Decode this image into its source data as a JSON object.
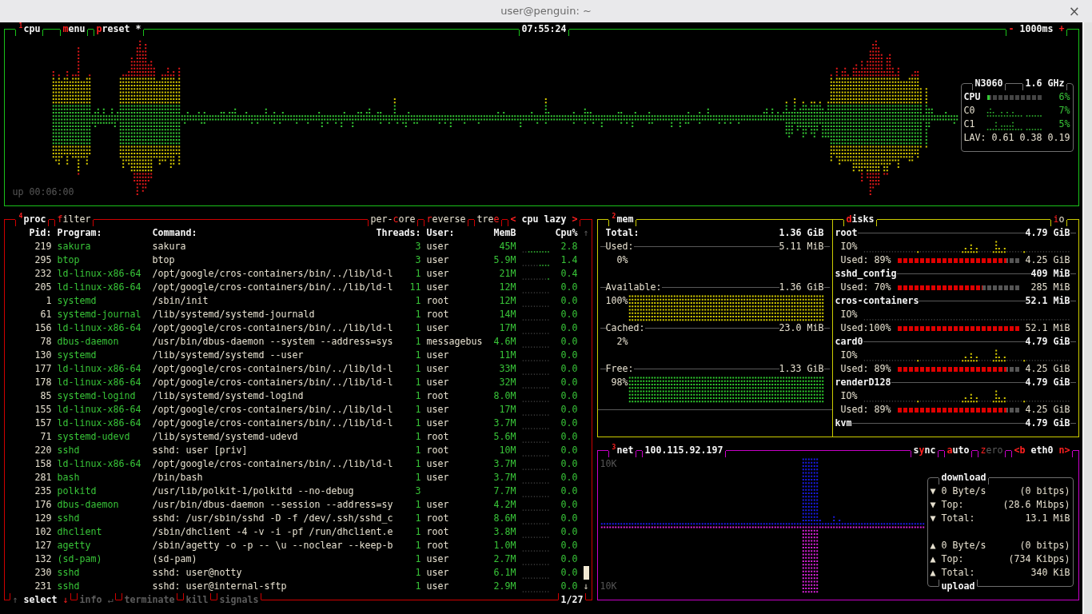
{
  "window": {
    "title": "user@penguin: ~",
    "close": "×"
  },
  "cpu": {
    "title": "$^{1}$cpu",
    "options": [
      {
        "key": "m",
        "after": "enu"
      },
      {
        "key": "p",
        "after": "reset *"
      }
    ],
    "clock": "07:55:24",
    "interval": {
      "minus": "-",
      "value": "1000ms",
      "plus": "+"
    },
    "uptime": "up 00:06:00",
    "info": {
      "model": "N3060",
      "frequency": "1.6 GHz",
      "total": {
        "label": "CPU",
        "level": 0.06,
        "value": "6%"
      },
      "cores": [
        {
          "label": "C0",
          "value": "7%"
        },
        {
          "label": "C1",
          "value": "5%"
        }
      ],
      "load": "LAV: 0.61 0.38 0.19"
    }
  },
  "proc": {
    "title": "$^{4}$proc",
    "filter": {
      "key": "f",
      "after": "ilter"
    },
    "toggles": [
      {
        "before": "per-",
        "key": "c",
        "after": "ore"
      },
      {
        "key": "r",
        "after": "everse"
      },
      {
        "before": "tre",
        "key": "e"
      }
    ],
    "sort": {
      "prev": "<",
      "label": "cpu lazy",
      "next": ">"
    },
    "columns": [
      "Pid:",
      "Program:",
      "Command:",
      "Threads:",
      "User:",
      "MemB",
      "Cpu%"
    ],
    "scroll_up": "↑",
    "scroll_down": "↓",
    "rows": [
      {
        "pid": "219",
        "program": "sakura",
        "command": "sakura",
        "threads": "3",
        "user": "user",
        "mem": "45M",
        "cpu": "2.8"
      },
      {
        "pid": "295",
        "program": "btop",
        "command": "btop",
        "threads": "3",
        "user": "user",
        "mem": "5.9M",
        "cpu": "1.4"
      },
      {
        "pid": "232",
        "program": "ld-linux-x86-64",
        "command": "/opt/google/cros-containers/bin/../lib/ld-l",
        "threads": "1",
        "user": "user",
        "mem": "21M",
        "cpu": "0.4"
      },
      {
        "pid": "205",
        "program": "ld-linux-x86-64",
        "command": "/opt/google/cros-containers/bin/../lib/ld-l",
        "threads": "11",
        "user": "user",
        "mem": "12M",
        "cpu": "0.0"
      },
      {
        "pid": "1",
        "program": "systemd",
        "command": "/sbin/init",
        "threads": "1",
        "user": "root",
        "mem": "12M",
        "cpu": "0.0"
      },
      {
        "pid": "61",
        "program": "systemd-journal",
        "command": "/lib/systemd/systemd-journald",
        "threads": "1",
        "user": "root",
        "mem": "14M",
        "cpu": "0.0"
      },
      {
        "pid": "156",
        "program": "ld-linux-x86-64",
        "command": "/opt/google/cros-containers/bin/../lib/ld-l",
        "threads": "1",
        "user": "user",
        "mem": "17M",
        "cpu": "0.0"
      },
      {
        "pid": "78",
        "program": "dbus-daemon",
        "command": "/usr/bin/dbus-daemon --system --address=sys",
        "threads": "1",
        "user": "messagebus",
        "mem": "4.6M",
        "cpu": "0.0"
      },
      {
        "pid": "130",
        "program": "systemd",
        "command": "/lib/systemd/systemd --user",
        "threads": "1",
        "user": "user",
        "mem": "11M",
        "cpu": "0.0"
      },
      {
        "pid": "177",
        "program": "ld-linux-x86-64",
        "command": "/opt/google/cros-containers/bin/../lib/ld-l",
        "threads": "1",
        "user": "user",
        "mem": "33M",
        "cpu": "0.0"
      },
      {
        "pid": "178",
        "program": "ld-linux-x86-64",
        "command": "/opt/google/cros-containers/bin/../lib/ld-l",
        "threads": "1",
        "user": "user",
        "mem": "32M",
        "cpu": "0.0"
      },
      {
        "pid": "85",
        "program": "systemd-logind",
        "command": "/lib/systemd/systemd-logind",
        "threads": "1",
        "user": "root",
        "mem": "8.0M",
        "cpu": "0.0"
      },
      {
        "pid": "155",
        "program": "ld-linux-x86-64",
        "command": "/opt/google/cros-containers/bin/../lib/ld-l",
        "threads": "1",
        "user": "user",
        "mem": "17M",
        "cpu": "0.0"
      },
      {
        "pid": "157",
        "program": "ld-linux-x86-64",
        "command": "/opt/google/cros-containers/bin/../lib/ld-l",
        "threads": "1",
        "user": "user",
        "mem": "3.7M",
        "cpu": "0.0"
      },
      {
        "pid": "71",
        "program": "systemd-udevd",
        "command": "/lib/systemd/systemd-udevd",
        "threads": "1",
        "user": "root",
        "mem": "5.6M",
        "cpu": "0.0"
      },
      {
        "pid": "220",
        "program": "sshd",
        "command": "sshd: user [priv]",
        "threads": "1",
        "user": "root",
        "mem": "10M",
        "cpu": "0.0"
      },
      {
        "pid": "158",
        "program": "ld-linux-x86-64",
        "command": "/opt/google/cros-containers/bin/../lib/ld-l",
        "threads": "1",
        "user": "user",
        "mem": "3.7M",
        "cpu": "0.0"
      },
      {
        "pid": "281",
        "program": "bash",
        "command": "/bin/bash",
        "threads": "1",
        "user": "user",
        "mem": "3.7M",
        "cpu": "0.0"
      },
      {
        "pid": "235",
        "program": "polkitd",
        "command": "/usr/lib/polkit-1/polkitd --no-debug",
        "threads": "3",
        "mem": "7.7M",
        "cpu": "0.0"
      },
      {
        "pid": "176",
        "program": "dbus-daemon",
        "command": "/usr/bin/dbus-daemon --session --address=sy",
        "threads": "1",
        "user": "user",
        "mem": "4.2M",
        "cpu": "0.0"
      },
      {
        "pid": "129",
        "program": "sshd",
        "command": "sshd: /usr/sbin/sshd -D -f /dev/.ssh/sshd_c",
        "threads": "1",
        "user": "root",
        "mem": "8.6M",
        "cpu": "0.0"
      },
      {
        "pid": "102",
        "program": "dhclient",
        "command": "/sbin/dhclient -4 -v -i -pf /run/dhclient.e",
        "threads": "1",
        "user": "root",
        "mem": "3.8M",
        "cpu": "0.0"
      },
      {
        "pid": "127",
        "program": "agetty",
        "command": "/sbin/agetty -o -p -- \\u --noclear --keep-b",
        "threads": "1",
        "user": "root",
        "mem": "1.0M",
        "cpu": "0.0"
      },
      {
        "pid": "132",
        "program": "(sd-pam)",
        "command": "(sd-pam)",
        "threads": "1",
        "user": "user",
        "mem": "2.7M",
        "cpu": "0.0"
      },
      {
        "pid": "230",
        "program": "sshd",
        "command": "sshd: user@notty",
        "threads": "1",
        "user": "user",
        "mem": "6.1M",
        "cpu": "0.0"
      },
      {
        "pid": "231",
        "program": "sshd",
        "command": "sshd: user@internal-sftp",
        "threads": "1",
        "user": "user",
        "mem": "2.9M",
        "cpu": "0.0"
      }
    ],
    "footer": [
      {
        "key_before": "↑",
        "label": "select",
        "key_after": "↓",
        "disabled": false
      },
      {
        "label": "info",
        "key_after": "↵",
        "disabled": true
      },
      {
        "label": "terminate",
        "disabled": true
      },
      {
        "label": "kill",
        "disabled": true
      },
      {
        "label": "signals",
        "disabled": true
      }
    ],
    "count": "1/27"
  },
  "mem": {
    "title": "$^{2}$mem",
    "total": {
      "label": "Total:",
      "value": "1.36 GiB"
    },
    "stats": [
      {
        "label": "Used:",
        "value": "5.11 MiB",
        "percent": "0%"
      },
      {
        "label": "Available:",
        "value": "1.36 GiB",
        "percent": "100%",
        "level": 1,
        "color": "#d7cf00"
      },
      {
        "label": "Cached:",
        "value": "23.0 MiB",
        "percent": "2%"
      },
      {
        "label": "Free:",
        "value": "1.33 GiB",
        "percent": "98%",
        "level": 0.98,
        "color": "#2ecb2e"
      }
    ]
  },
  "disks": {
    "title": {
      "key": "d",
      "after": "isks"
    },
    "io": {
      "key": "i",
      "after": "o"
    },
    "items": [
      {
        "name": "root",
        "size": "4.79 GiB",
        "io_label": "IO%",
        "io_active": true,
        "used_label": "Used:",
        "used_percent": "89%",
        "level": 0.89,
        "used": "4.25 GiB"
      },
      {
        "name": "sshd_config",
        "size": "409 MiB",
        "used_label": "Used:",
        "used_percent": "70%",
        "level": 0.7,
        "used": "285 MiB"
      },
      {
        "name": "cros-containers",
        "size": "52.1 MiB",
        "io_label": "IO%",
        "io_active": false,
        "used_label": "Used:",
        "used_percent": "100%",
        "level": 1,
        "used": "52.1 MiB"
      },
      {
        "name": "card0",
        "size": "4.79 GiB",
        "io_label": "IO%",
        "io_active": true,
        "used_label": "Used:",
        "used_percent": "89%",
        "level": 0.89,
        "used": "4.25 GiB"
      },
      {
        "name": "renderD128",
        "size": "4.79 GiB",
        "io_label": "IO%",
        "io_active": true,
        "used_label": "Used:",
        "used_percent": "89%",
        "level": 0.89,
        "used": "4.25 GiB"
      },
      {
        "name": "kvm",
        "size": "4.79 GiB"
      }
    ]
  },
  "net": {
    "title": "$^{3}$net",
    "address": "100.115.92.197",
    "options": [
      {
        "before": "s",
        "key": "y",
        "after": "nc",
        "on": true
      },
      {
        "key": "a",
        "after": "uto",
        "on": true
      },
      {
        "key": "z",
        "after": "ero",
        "on": false
      }
    ],
    "interface": {
      "prev": "<b",
      "name": "eth0",
      "next": "n>"
    },
    "scale_top": "10K",
    "scale_bottom": "10K",
    "download": {
      "title": "download",
      "rows": [
        {
          "arrow": "▼",
          "label": "0 Byte/s",
          "value": "(0 bitps)"
        },
        {
          "arrow": "▼",
          "label": "Top:",
          "value": "(28.6 Mibps)"
        },
        {
          "arrow": "▼",
          "label": "Total:",
          "value": "13.1 MiB"
        }
      ]
    },
    "upload": {
      "title": "upload",
      "rows": [
        {
          "arrow": "▲",
          "label": "0 Byte/s",
          "value": "(0 bitps)"
        },
        {
          "arrow": "▲",
          "label": "Top:",
          "value": "(734 Kibps)"
        },
        {
          "arrow": "▲",
          "label": "Total:",
          "value": "340 KiB"
        }
      ]
    }
  }
}
